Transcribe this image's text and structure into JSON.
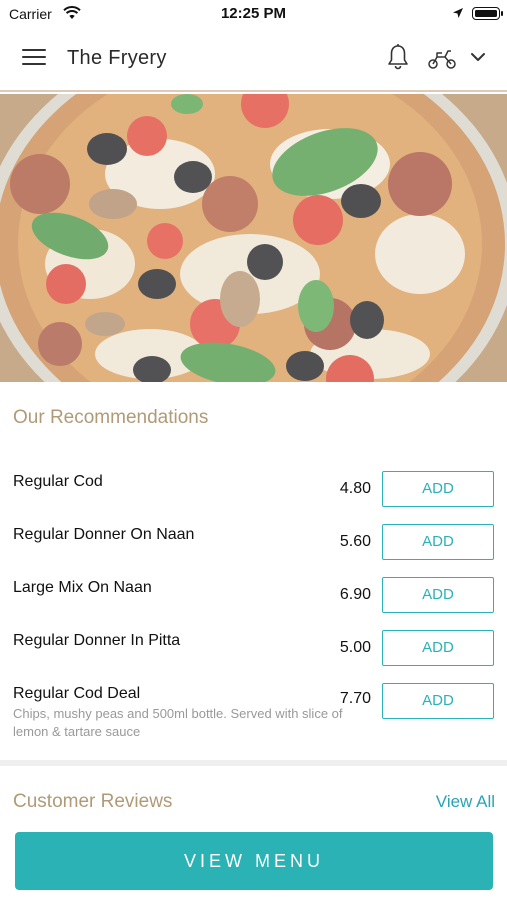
{
  "status_bar": {
    "carrier": "Carrier",
    "time": "12:25 PM"
  },
  "header": {
    "title": "The Fryery",
    "icons": [
      "menu-icon",
      "bell-icon",
      "scooter-icon",
      "chevron-down-icon"
    ]
  },
  "hero": {
    "image": "pizza-photo"
  },
  "recommendations": {
    "title": "Our Recommendations",
    "items": [
      {
        "name": "Regular Cod",
        "description": "",
        "price": "4.80",
        "button": "ADD"
      },
      {
        "name": "Regular Donner On Naan",
        "description": "",
        "price": "5.60",
        "button": "ADD"
      },
      {
        "name": "Large Mix On Naan",
        "description": "",
        "price": "6.90",
        "button": "ADD"
      },
      {
        "name": "Regular Donner In Pitta",
        "description": "",
        "price": "5.00",
        "button": "ADD"
      },
      {
        "name": "Regular Cod Deal",
        "description": "Chips, mushy peas and 500ml bottle.  Served with slice of lemon & tartare sauce",
        "price": "7.70",
        "button": "ADD"
      }
    ]
  },
  "reviews": {
    "title": "Customer Reviews",
    "view_all": "View All"
  },
  "footer": {
    "view_menu": "VIEW MENU"
  },
  "colors": {
    "accent": "#2ab2b5",
    "section_title": "#b09a77",
    "link": "#2aa3b5"
  }
}
